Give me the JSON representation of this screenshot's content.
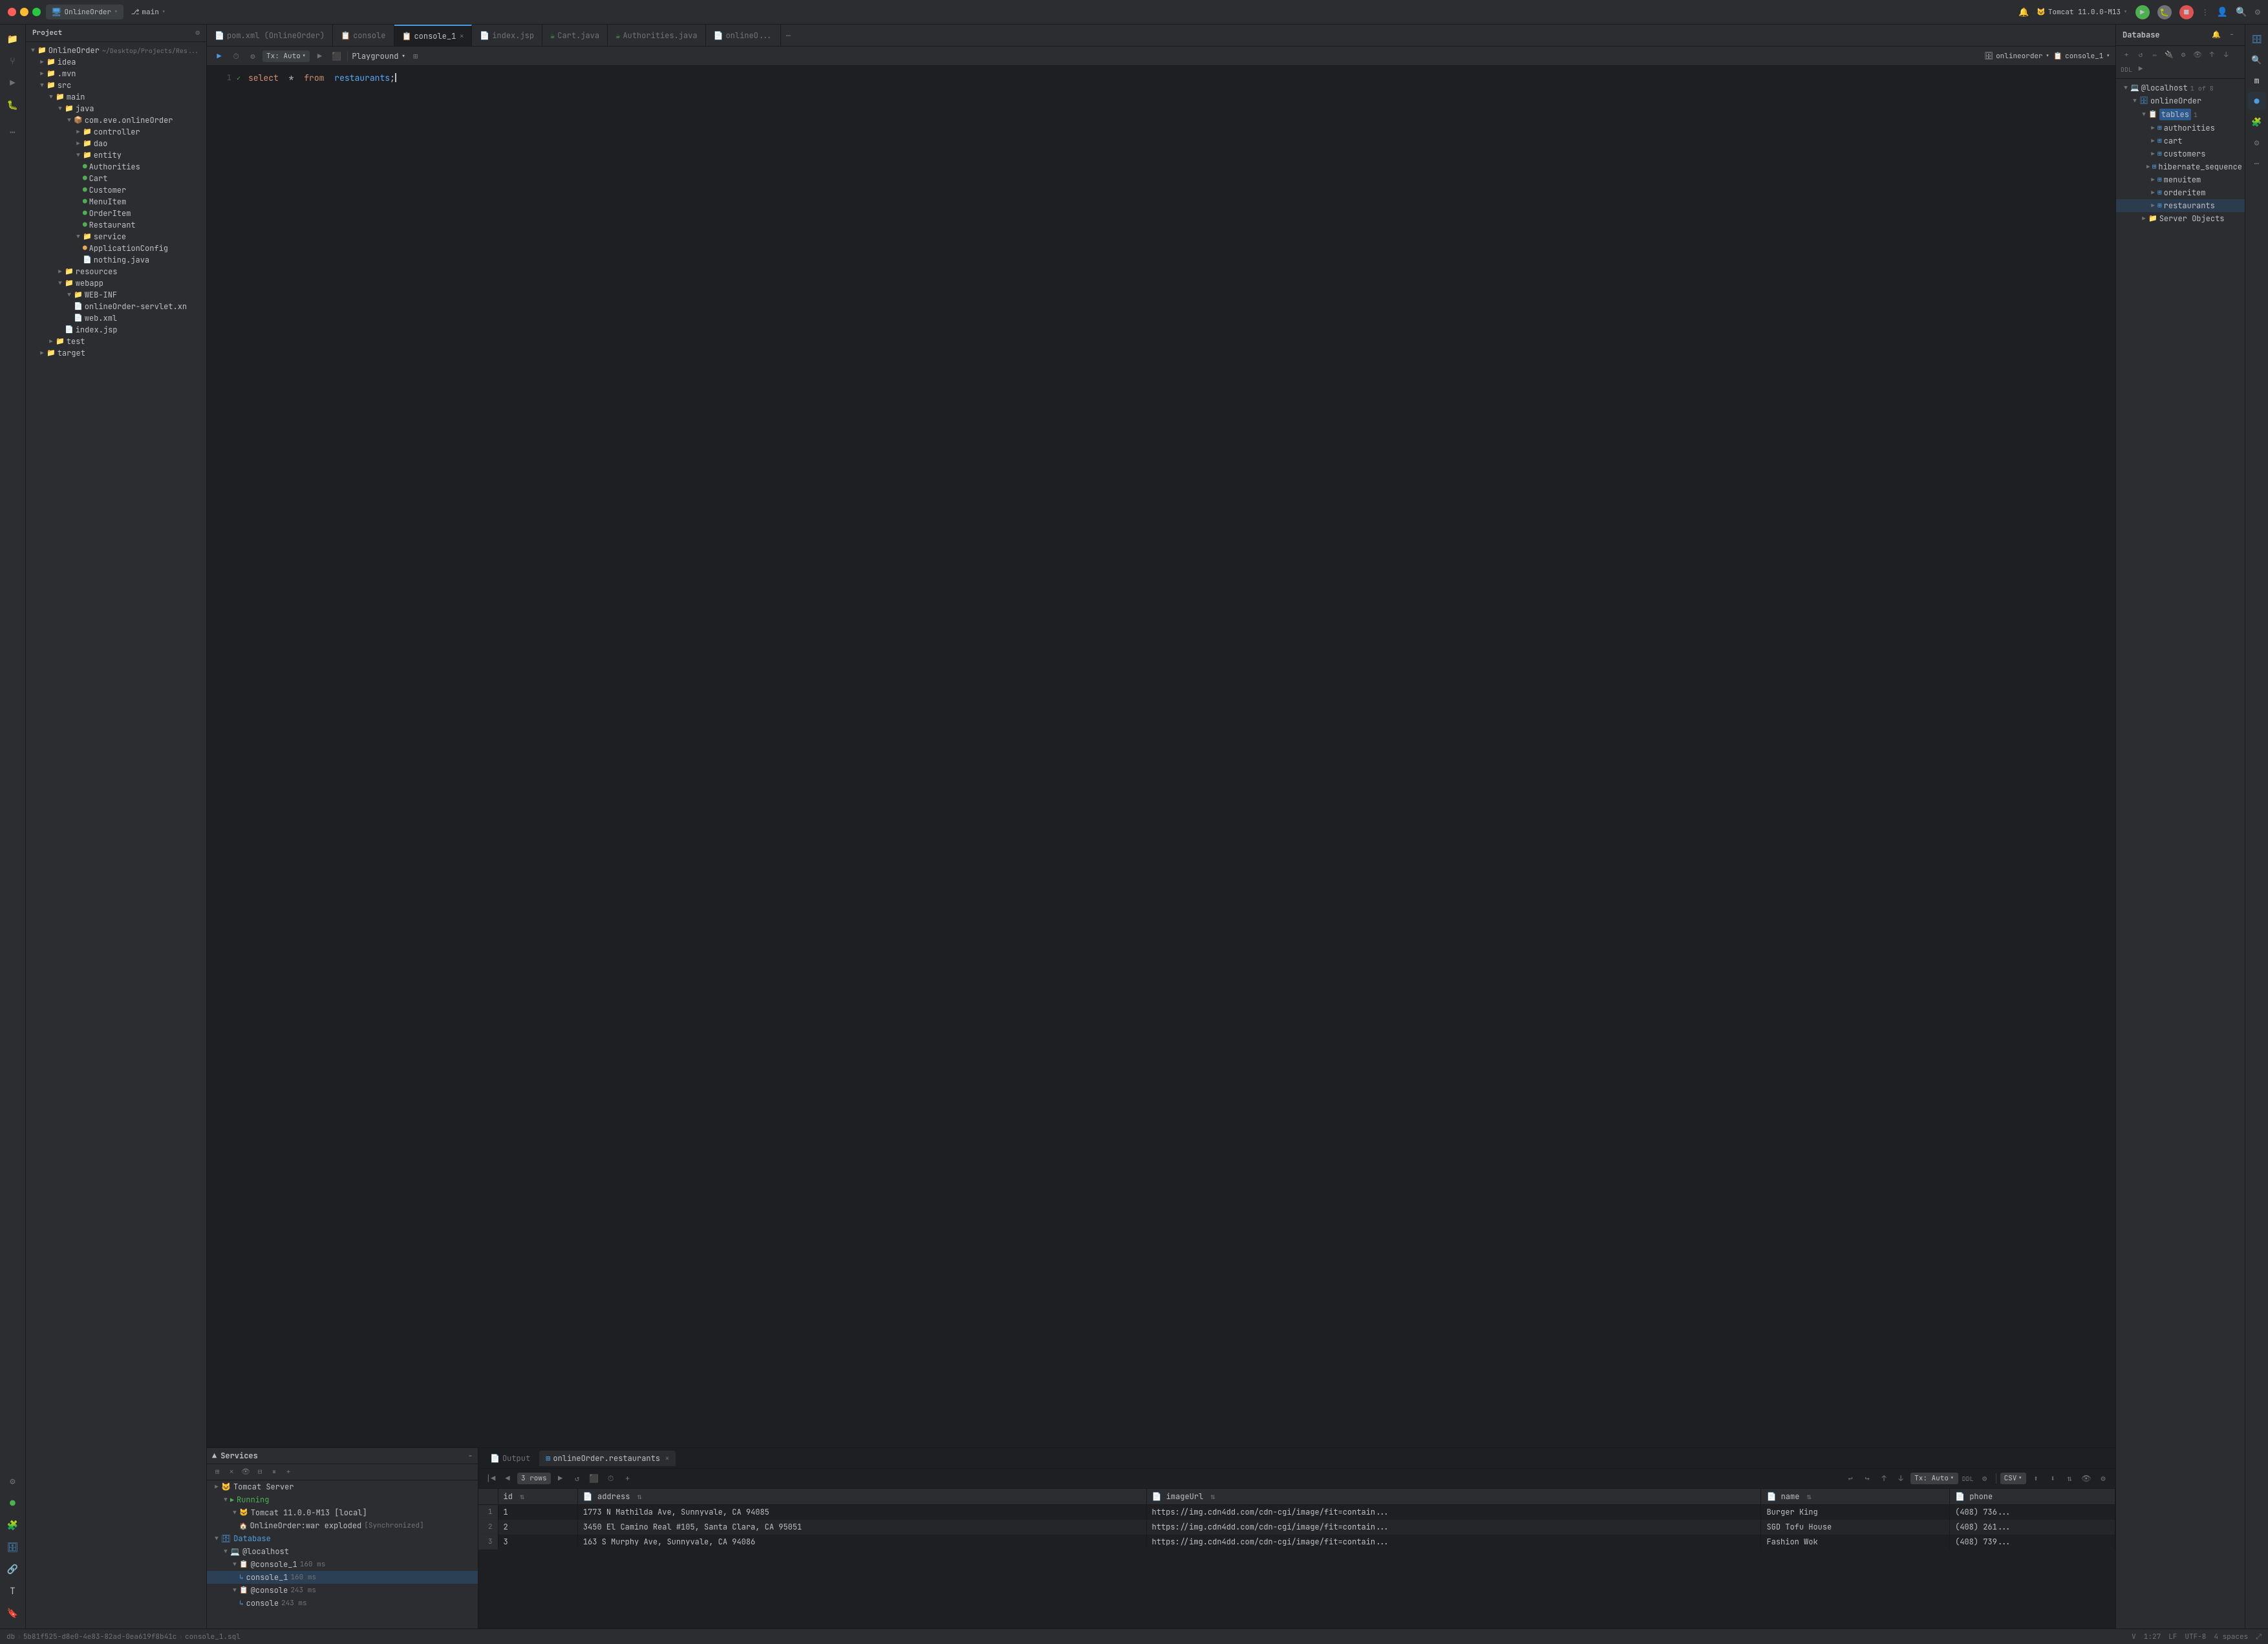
{
  "titlebar": {
    "project_name": "OnlineOrder",
    "branch": "main",
    "tomcat": "Tomcat 11.0.0-M13"
  },
  "tabs": [
    {
      "label": "pom.xml (OnlineOrder)",
      "icon": "📄",
      "active": false
    },
    {
      "label": "console",
      "icon": "📋",
      "active": false
    },
    {
      "label": "console_1",
      "icon": "📋",
      "active": true,
      "closeable": true
    },
    {
      "label": "index.jsp",
      "icon": "📄",
      "active": false
    },
    {
      "label": "Cart.java",
      "icon": "☕",
      "active": false
    },
    {
      "label": "Authorities.java",
      "icon": "☕",
      "active": false
    },
    {
      "label": "onlineO...",
      "icon": "📄",
      "active": false
    }
  ],
  "editor": {
    "toolbar": {
      "run_label": "▶",
      "tx_label": "Tx: Auto",
      "playground_label": "Playground",
      "db_connection": "onlineorder",
      "console_label": "console_1"
    },
    "code": "select * from restaurants;"
  },
  "db_panel": {
    "title": "Database",
    "items": [
      {
        "label": "@localhost",
        "badge": "1 of 8",
        "indent": 0,
        "type": "server"
      },
      {
        "label": "onlineOrder",
        "indent": 1,
        "type": "db"
      },
      {
        "label": "tables",
        "indent": 2,
        "type": "folder",
        "badge": "1"
      },
      {
        "label": "authorities",
        "indent": 3,
        "type": "table"
      },
      {
        "label": "cart",
        "indent": 3,
        "type": "table"
      },
      {
        "label": "customers",
        "indent": 3,
        "type": "table"
      },
      {
        "label": "hibernate_sequence",
        "indent": 3,
        "type": "table"
      },
      {
        "label": "menuitem",
        "indent": 3,
        "type": "table"
      },
      {
        "label": "orderitem",
        "indent": 3,
        "type": "table"
      },
      {
        "label": "restaurants",
        "indent": 3,
        "type": "table",
        "selected": true
      },
      {
        "label": "Server Objects",
        "indent": 2,
        "type": "folder"
      }
    ]
  },
  "file_tree": {
    "title": "Project",
    "items": [
      {
        "label": "OnlineOrder",
        "path": "~/Desktop/Projects/Res...",
        "indent": 0,
        "expanded": true
      },
      {
        "label": "idea",
        "indent": 1,
        "type": "folder"
      },
      {
        "label": ".mvn",
        "indent": 1,
        "type": "folder"
      },
      {
        "label": "src",
        "indent": 1,
        "type": "folder",
        "expanded": true
      },
      {
        "label": "main",
        "indent": 2,
        "type": "folder",
        "expanded": true
      },
      {
        "label": "java",
        "indent": 3,
        "type": "folder",
        "expanded": true
      },
      {
        "label": "com.eve.onlineOrder",
        "indent": 4,
        "type": "package",
        "expanded": true
      },
      {
        "label": "controller",
        "indent": 5,
        "type": "folder"
      },
      {
        "label": "dao",
        "indent": 5,
        "type": "folder"
      },
      {
        "label": "entity",
        "indent": 5,
        "type": "folder",
        "expanded": true
      },
      {
        "label": "Authorities",
        "indent": 6,
        "type": "class"
      },
      {
        "label": "Cart",
        "indent": 6,
        "type": "class"
      },
      {
        "label": "Customer",
        "indent": 6,
        "type": "class"
      },
      {
        "label": "MenuItem",
        "indent": 6,
        "type": "class"
      },
      {
        "label": "OrderItem",
        "indent": 6,
        "type": "class"
      },
      {
        "label": "Restaurant",
        "indent": 6,
        "type": "class"
      },
      {
        "label": "service",
        "indent": 5,
        "type": "folder",
        "expanded": true
      },
      {
        "label": "ApplicationConfig",
        "indent": 6,
        "type": "class2"
      },
      {
        "label": "nothing.java",
        "indent": 6,
        "type": "file"
      },
      {
        "label": "resources",
        "indent": 3,
        "type": "folder"
      },
      {
        "label": "webapp",
        "indent": 3,
        "type": "folder",
        "expanded": true
      },
      {
        "label": "WEB-INF",
        "indent": 4,
        "type": "folder",
        "expanded": true
      },
      {
        "label": "onlineOrder-servlet.xn",
        "indent": 5,
        "type": "xml"
      },
      {
        "label": "web.xml",
        "indent": 5,
        "type": "xml"
      },
      {
        "label": "index.jsp",
        "indent": 4,
        "type": "jsp"
      },
      {
        "label": "test",
        "indent": 2,
        "type": "folder"
      },
      {
        "label": "target",
        "indent": 1,
        "type": "folder"
      }
    ]
  },
  "services": {
    "title": "Services",
    "items": [
      {
        "label": "Tomcat Server",
        "indent": 0,
        "type": "server"
      },
      {
        "label": "Running",
        "indent": 1,
        "type": "running"
      },
      {
        "label": "Tomcat 11.0.0-M13 [local]",
        "indent": 2,
        "type": "tomcat"
      },
      {
        "label": "OnlineOrder:war exploded",
        "subtext": "[Synchronized]",
        "indent": 3,
        "type": "app"
      },
      {
        "label": "Database",
        "indent": 0,
        "type": "db-header"
      },
      {
        "label": "@localhost",
        "indent": 1,
        "type": "localhost"
      },
      {
        "label": "@console_1",
        "ms": "160 ms",
        "indent": 2,
        "type": "console"
      },
      {
        "label": "console_1",
        "ms": "160 ms",
        "indent": 3,
        "type": "console-item",
        "selected": true
      },
      {
        "label": "@console",
        "ms": "243 ms",
        "indent": 2,
        "type": "console"
      },
      {
        "label": "console",
        "ms": "243 ms",
        "indent": 3,
        "type": "console-item"
      }
    ]
  },
  "results": {
    "tabs": [
      {
        "label": "Output",
        "active": false
      },
      {
        "label": "onlineOrder.restaurants",
        "active": true,
        "closeable": true
      }
    ],
    "rows_count": "3 rows",
    "columns": [
      "id",
      "address",
      "imageUrl",
      "name",
      "phone"
    ],
    "rows": [
      {
        "id": "1",
        "address": "1773 N Mathilda Ave, Sunnyvale, CA 94085",
        "imageUrl": "https://img.cdn4dd.com/cdn-cgi/image/fit=contain...",
        "name": "Burger King",
        "phone": "(408) 736..."
      },
      {
        "id": "2",
        "address": "3450 El Camino Real #105, Santa Clara, CA 95051",
        "imageUrl": "https://img.cdn4dd.com/cdn-cgi/image/fit=contain...",
        "name": "SGD Tofu House",
        "phone": "(408) 261..."
      },
      {
        "id": "3",
        "address": "163 S Murphy Ave, Sunnyvale, CA 94086",
        "imageUrl": "https://img.cdn4dd.com/cdn-cgi/image/fit=contain...",
        "name": "Fashion Wok",
        "phone": "(408) 739..."
      }
    ]
  },
  "status_bar": {
    "path": "5b81f525-d8e0-4e83-82ad-0ea619f8b41c",
    "console": "console_1.sql",
    "position": "1:27",
    "line_ending": "LF",
    "encoding": "UTF-8",
    "indent": "4 spaces"
  }
}
